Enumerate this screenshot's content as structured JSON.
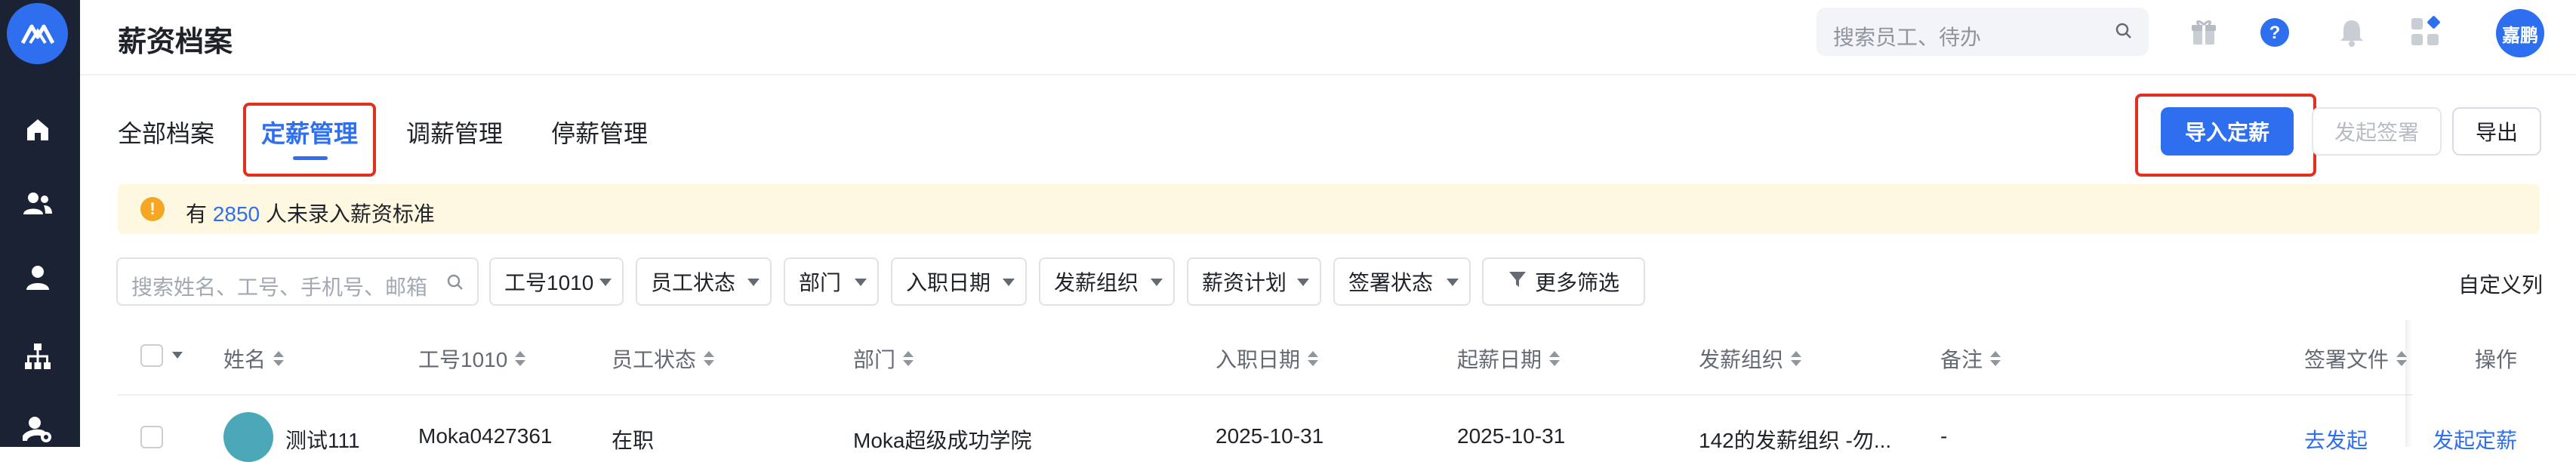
{
  "header": {
    "title": "薪资档案",
    "search_placeholder": "搜索员工、待办",
    "avatar_text": "嘉鹏"
  },
  "tabs": [
    {
      "label": "全部档案",
      "active": false
    },
    {
      "label": "定薪管理",
      "active": true
    },
    {
      "label": "调薪管理",
      "active": false
    },
    {
      "label": "停薪管理",
      "active": false
    }
  ],
  "actions": {
    "import": "导入定薪",
    "sign": "发起签署",
    "export": "导出"
  },
  "notice": {
    "prefix": "有",
    "count": "2850",
    "suffix": "人未录入薪资标准"
  },
  "filters": {
    "search_placeholder": "搜索姓名、工号、手机号、邮箱",
    "items": [
      "工号1010",
      "员工状态",
      "部门",
      "入职日期",
      "发薪组织",
      "薪资计划",
      "签署状态"
    ],
    "more": "更多筛选",
    "custom_columns": "自定义列"
  },
  "table": {
    "columns": [
      "姓名",
      "工号1010",
      "员工状态",
      "部门",
      "入职日期",
      "起薪日期",
      "发薪组织",
      "备注",
      "签署文件",
      "操作"
    ],
    "rows": [
      {
        "name": "测试111",
        "emp_no": "Moka0427361",
        "status": "在职",
        "dept": "Moka超级成功学院",
        "hire_date": "2025-10-31",
        "start_date": "2025-10-31",
        "pay_org": "142的发薪组织 -勿...",
        "note": "-",
        "sign_file": "去发起",
        "action": "发起定薪"
      }
    ]
  },
  "colors": {
    "nav_bg": "#1b2233",
    "accent": "#2e6ff0",
    "highlight": "#e0301e",
    "notice_bg": "#fff8e1",
    "warn": "#f5a623"
  }
}
